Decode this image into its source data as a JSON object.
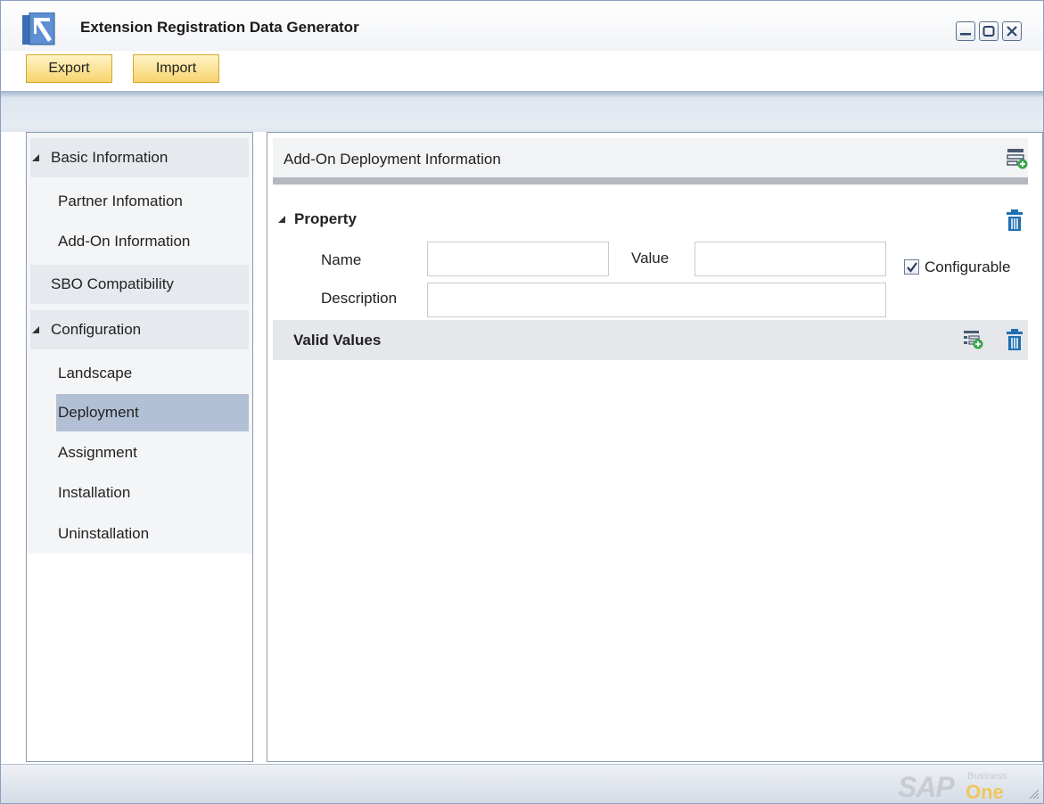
{
  "window": {
    "title": "Extension Registration Data Generator",
    "controls": [
      "minimize-icon",
      "maximize-icon",
      "close-icon"
    ]
  },
  "toolbar": {
    "export_label": "Export",
    "import_label": "Import",
    "button_color": "#f7d46e"
  },
  "nav": {
    "groups": [
      {
        "label": "Basic Information",
        "expanded": true,
        "items": [
          "Partner Infomation",
          "Add-On Information"
        ]
      },
      {
        "label": "SBO Compatibility",
        "expanded": false,
        "items": []
      },
      {
        "label": "Configuration",
        "expanded": true,
        "items": [
          "Landscape",
          "Deployment",
          "Assignment",
          "Installation",
          "Uninstallation"
        ]
      }
    ],
    "selected": "Deployment",
    "selected_color": "#b2c0d6"
  },
  "content": {
    "title": "Add-On Deployment Information",
    "property": {
      "heading": "Property",
      "name_label": "Name",
      "name_value": "",
      "value_label": "Value",
      "value_value": "",
      "description_label": "Description",
      "description_value": "",
      "configurable_label": "Configurable",
      "configurable_checked": true
    },
    "valid_values": {
      "heading": "Valid Values"
    },
    "icon_color": "#1f6fb3"
  },
  "statusbar": {
    "logo_sap": "SAP",
    "logo_business": "Business",
    "logo_one": "One"
  }
}
